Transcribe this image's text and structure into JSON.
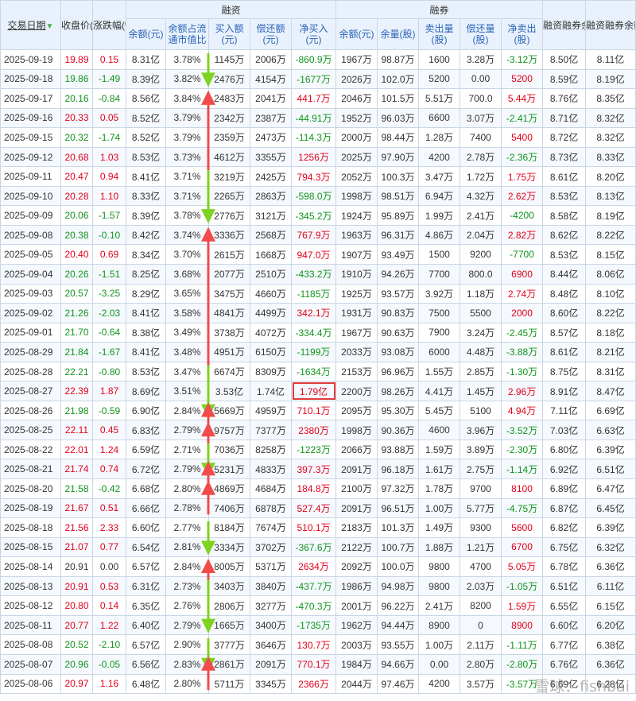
{
  "headers": {
    "date": "交易日期",
    "close": "收盘价(元)",
    "change": "涨跌幅(%)",
    "rz_group": "融资",
    "rq_group": "融券",
    "rz_balance": "余额(元)",
    "rz_ratio": "余额占流通市值比",
    "rz_buy": "买入额(元)",
    "rz_repay": "偿还额(元)",
    "rz_net": "净买入(元)",
    "rq_balance": "余额(元)",
    "rq_volume": "余量(股)",
    "rq_sell": "卖出量(股)",
    "rq_repay": "偿还量(股)",
    "rq_net": "净卖出(股)",
    "total_balance": "融资融券余额(元)",
    "diff_balance": "融资融券余额差值(元)"
  },
  "sort_icon": "sort-down-icon",
  "colors": {
    "up": "#e3001b",
    "down": "#10941e",
    "arrow_up": "#f24b4b",
    "arrow_down": "#7ed321"
  },
  "watermark": "雪球：fishbai",
  "rows": [
    [
      "2025-09-19",
      "19.89",
      "0.15",
      "8.31亿",
      "3.78%",
      "1145万",
      "2006万",
      "-860.9万",
      "1967万",
      "98.87万",
      "1600",
      "3.28万",
      "-3.12万",
      "8.50亿",
      "8.11亿"
    ],
    [
      "2025-09-18",
      "19.86",
      "-1.49",
      "8.39亿",
      "3.82%",
      "2476万",
      "4154万",
      "-1677万",
      "2026万",
      "102.0万",
      "5200",
      "0.00",
      "5200",
      "8.59亿",
      "8.19亿"
    ],
    [
      "2025-09-17",
      "20.16",
      "-0.84",
      "8.56亿",
      "3.84%",
      "2483万",
      "2041万",
      "441.7万",
      "2046万",
      "101.5万",
      "5.51万",
      "700.0",
      "5.44万",
      "8.76亿",
      "8.35亿"
    ],
    [
      "2025-09-16",
      "20.33",
      "0.05",
      "8.52亿",
      "3.79%",
      "2342万",
      "2387万",
      "-44.91万",
      "1952万",
      "96.03万",
      "6600",
      "3.07万",
      "-2.41万",
      "8.71亿",
      "8.32亿"
    ],
    [
      "2025-09-15",
      "20.32",
      "-1.74",
      "8.52亿",
      "3.79%",
      "2359万",
      "2473万",
      "-114.3万",
      "2000万",
      "98.44万",
      "1.28万",
      "7400",
      "5400",
      "8.72亿",
      "8.32亿"
    ],
    [
      "2025-09-12",
      "20.68",
      "1.03",
      "8.53亿",
      "3.73%",
      "4612万",
      "3355万",
      "1256万",
      "2025万",
      "97.90万",
      "4200",
      "2.78万",
      "-2.36万",
      "8.73亿",
      "8.33亿"
    ],
    [
      "2025-09-11",
      "20.47",
      "0.94",
      "8.41亿",
      "3.71%",
      "3219万",
      "2425万",
      "794.3万",
      "2052万",
      "100.3万",
      "3.47万",
      "1.72万",
      "1.75万",
      "8.61亿",
      "8.20亿"
    ],
    [
      "2025-09-10",
      "20.28",
      "1.10",
      "8.33亿",
      "3.71%",
      "2265万",
      "2863万",
      "-598.0万",
      "1998万",
      "98.51万",
      "6.94万",
      "4.32万",
      "2.62万",
      "8.53亿",
      "8.13亿"
    ],
    [
      "2025-09-09",
      "20.06",
      "-1.57",
      "8.39亿",
      "3.78%",
      "2776万",
      "3121万",
      "-345.2万",
      "1924万",
      "95.89万",
      "1.99万",
      "2.41万",
      "-4200",
      "8.58亿",
      "8.19亿"
    ],
    [
      "2025-09-08",
      "20.38",
      "-0.10",
      "8.42亿",
      "3.74%",
      "3336万",
      "2568万",
      "767.9万",
      "1963万",
      "96.31万",
      "4.86万",
      "2.04万",
      "2.82万",
      "8.62亿",
      "8.22亿"
    ],
    [
      "2025-09-05",
      "20.40",
      "0.69",
      "8.34亿",
      "3.70%",
      "2615万",
      "1668万",
      "947.0万",
      "1907万",
      "93.49万",
      "1500",
      "9200",
      "-7700",
      "8.53亿",
      "8.15亿"
    ],
    [
      "2025-09-04",
      "20.26",
      "-1.51",
      "8.25亿",
      "3.68%",
      "2077万",
      "2510万",
      "-433.2万",
      "1910万",
      "94.26万",
      "7700",
      "800.0",
      "6900",
      "8.44亿",
      "8.06亿"
    ],
    [
      "2025-09-03",
      "20.57",
      "-3.25",
      "8.29亿",
      "3.65%",
      "3475万",
      "4660万",
      "-1185万",
      "1925万",
      "93.57万",
      "3.92万",
      "1.18万",
      "2.74万",
      "8.48亿",
      "8.10亿"
    ],
    [
      "2025-09-02",
      "21.26",
      "-2.03",
      "8.41亿",
      "3.58%",
      "4841万",
      "4499万",
      "342.1万",
      "1931万",
      "90.83万",
      "7500",
      "5500",
      "2000",
      "8.60亿",
      "8.22亿"
    ],
    [
      "2025-09-01",
      "21.70",
      "-0.64",
      "8.38亿",
      "3.49%",
      "3738万",
      "4072万",
      "-334.4万",
      "1967万",
      "90.63万",
      "7900",
      "3.24万",
      "-2.45万",
      "8.57亿",
      "8.18亿"
    ],
    [
      "2025-08-29",
      "21.84",
      "-1.67",
      "8.41亿",
      "3.48%",
      "4951万",
      "6150万",
      "-1199万",
      "2033万",
      "93.08万",
      "6000",
      "4.48万",
      "-3.88万",
      "8.61亿",
      "8.21亿"
    ],
    [
      "2025-08-28",
      "22.21",
      "-0.80",
      "8.53亿",
      "3.47%",
      "6674万",
      "8309万",
      "-1634万",
      "2153万",
      "96.96万",
      "1.55万",
      "2.85万",
      "-1.30万",
      "8.75亿",
      "8.31亿"
    ],
    [
      "2025-08-27",
      "22.39",
      "1.87",
      "8.69亿",
      "3.51%",
      "3.53亿",
      "1.74亿",
      "1.79亿",
      "2200万",
      "98.26万",
      "4.41万",
      "1.45万",
      "2.96万",
      "8.91亿",
      "8.47亿"
    ],
    [
      "2025-08-26",
      "21.98",
      "-0.59",
      "6.90亿",
      "2.84%",
      "5669万",
      "4959万",
      "710.1万",
      "2095万",
      "95.30万",
      "5.45万",
      "5100",
      "4.94万",
      "7.11亿",
      "6.69亿"
    ],
    [
      "2025-08-25",
      "22.11",
      "0.45",
      "6.83亿",
      "2.79%",
      "9757万",
      "7377万",
      "2380万",
      "1998万",
      "90.36万",
      "4600",
      "3.96万",
      "-3.52万",
      "7.03亿",
      "6.63亿"
    ],
    [
      "2025-08-22",
      "22.01",
      "1.24",
      "6.59亿",
      "2.71%",
      "7036万",
      "8258万",
      "-1223万",
      "2066万",
      "93.88万",
      "1.59万",
      "3.89万",
      "-2.30万",
      "6.80亿",
      "6.39亿"
    ],
    [
      "2025-08-21",
      "21.74",
      "0.74",
      "6.72亿",
      "2.79%",
      "5231万",
      "4833万",
      "397.3万",
      "2091万",
      "96.18万",
      "1.61万",
      "2.75万",
      "-1.14万",
      "6.92亿",
      "6.51亿"
    ],
    [
      "2025-08-20",
      "21.58",
      "-0.42",
      "6.68亿",
      "2.80%",
      "4869万",
      "4684万",
      "184.8万",
      "2100万",
      "97.32万",
      "1.78万",
      "9700",
      "8100",
      "6.89亿",
      "6.47亿"
    ],
    [
      "2025-08-19",
      "21.67",
      "0.51",
      "6.66亿",
      "2.78%",
      "7406万",
      "6878万",
      "527.4万",
      "2091万",
      "96.51万",
      "1.00万",
      "5.77万",
      "-4.75万",
      "6.87亿",
      "6.45亿"
    ],
    [
      "2025-08-18",
      "21.56",
      "2.33",
      "6.60亿",
      "2.77%",
      "8184万",
      "7674万",
      "510.1万",
      "2183万",
      "101.3万",
      "1.49万",
      "9300",
      "5600",
      "6.82亿",
      "6.39亿"
    ],
    [
      "2025-08-15",
      "21.07",
      "0.77",
      "6.54亿",
      "2.81%",
      "3334万",
      "3702万",
      "-367.6万",
      "2122万",
      "100.7万",
      "1.88万",
      "1.21万",
      "6700",
      "6.75亿",
      "6.32亿"
    ],
    [
      "2025-08-14",
      "20.91",
      "0.00",
      "6.57亿",
      "2.84%",
      "8005万",
      "5371万",
      "2634万",
      "2092万",
      "100.0万",
      "9800",
      "4700",
      "5.05万",
      "6.78亿",
      "6.36亿"
    ],
    [
      "2025-08-13",
      "20.91",
      "0.53",
      "6.31亿",
      "2.73%",
      "3403万",
      "3840万",
      "-437.7万",
      "1986万",
      "94.98万",
      "9800",
      "2.03万",
      "-1.05万",
      "6.51亿",
      "6.11亿"
    ],
    [
      "2025-08-12",
      "20.80",
      "0.14",
      "6.35亿",
      "2.76%",
      "2806万",
      "3277万",
      "-470.3万",
      "2001万",
      "96.22万",
      "2.41万",
      "8200",
      "1.59万",
      "6.55亿",
      "6.15亿"
    ],
    [
      "2025-08-11",
      "20.77",
      "1.22",
      "6.40亿",
      "2.79%",
      "1665万",
      "3400万",
      "-1735万",
      "1962万",
      "94.44万",
      "8900",
      "0",
      "8900",
      "6.60亿",
      "6.20亿"
    ],
    [
      "2025-08-08",
      "20.52",
      "-2.10",
      "6.57亿",
      "2.90%",
      "3777万",
      "3646万",
      "130.7万",
      "2003万",
      "93.55万",
      "1.00万",
      "2.11万",
      "-1.11万",
      "6.77亿",
      "6.38亿"
    ],
    [
      "2025-08-07",
      "20.96",
      "-0.05",
      "6.56亿",
      "2.83%",
      "2861万",
      "2091万",
      "770.1万",
      "1984万",
      "94.66万",
      "0.00",
      "2.80万",
      "-2.80万",
      "6.76亿",
      "6.36亿"
    ],
    [
      "2025-08-06",
      "20.97",
      "1.16",
      "6.48亿",
      "2.80%",
      "5711万",
      "3345万",
      "2366万",
      "2044万",
      "97.46万",
      "4200",
      "3.57万",
      "-3.57万",
      "6.69亿",
      "6.28亿"
    ]
  ],
  "highlight": {
    "row": 17,
    "col": 7
  },
  "arrows": [
    {
      "dir": "down",
      "row": 0,
      "to_row": 1
    },
    {
      "dir": "up",
      "row": 2,
      "to_row": 6
    },
    {
      "dir": "down",
      "row": 6,
      "to_row": 8
    },
    {
      "dir": "up",
      "row": 9,
      "to_row": 16
    },
    {
      "dir": "down",
      "row": 16,
      "to_row": 18
    },
    {
      "dir": "up",
      "row": 18,
      "to_row": 19
    },
    {
      "dir": "up",
      "row": 19,
      "to_row": 20
    },
    {
      "dir": "down",
      "row": 20,
      "to_row": 21
    },
    {
      "dir": "up",
      "row": 21,
      "to_row": 22
    },
    {
      "dir": "up",
      "row": 22,
      "to_row": 23
    },
    {
      "dir": "down",
      "row": 24,
      "to_row": 25
    },
    {
      "dir": "up",
      "row": 26,
      "to_row": 27
    },
    {
      "dir": "down",
      "row": 27,
      "to_row": 29
    },
    {
      "dir": "down",
      "row": 30,
      "to_row": 31
    },
    {
      "dir": "up",
      "row": 31,
      "to_row": 32
    }
  ]
}
